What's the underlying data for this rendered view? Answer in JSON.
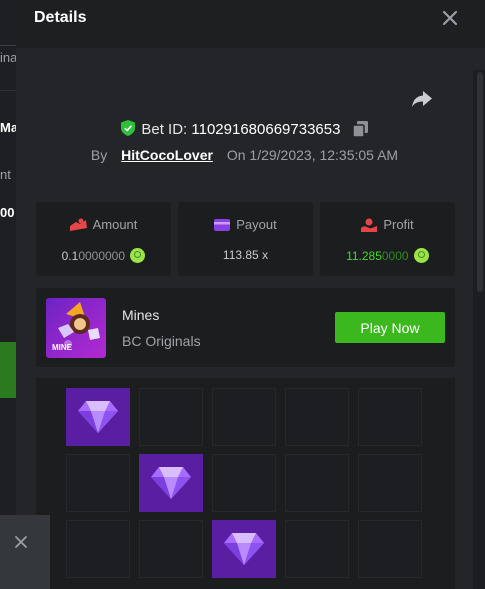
{
  "modal": {
    "title": "Details"
  },
  "bet": {
    "id_label": "Bet ID:",
    "id_value": "110291680669733653",
    "by_label": "By",
    "username": "HitCocoLover",
    "on_label": "On",
    "datetime": "1/29/2023, 12:35:05 AM"
  },
  "stats": {
    "amount_label": "Amount",
    "amount_bright": "0.1",
    "amount_dim": "0000000",
    "payout_label": "Payout",
    "payout_value": "113.85 x",
    "profit_label": "Profit",
    "profit_bright": "11.285",
    "profit_dim": "0000"
  },
  "game": {
    "name": "Mines",
    "provider": "BC Originals",
    "thumb_text": "MINE",
    "play_label": "Play Now"
  },
  "board": {
    "tiles": [
      [
        "gem",
        "empty",
        "empty",
        "empty",
        "empty"
      ],
      [
        "empty",
        "gem",
        "empty",
        "empty",
        "empty"
      ],
      [
        "empty",
        "empty",
        "gem",
        "empty",
        "empty"
      ]
    ]
  },
  "background": {
    "fragments": [
      "ina",
      "Ma",
      "nt",
      "00"
    ]
  },
  "colors": {
    "accent_green": "#3cb81f",
    "gem_tile": "#5a1ea3",
    "profit_green": "#45d62a",
    "shield_green": "#2fbf3a"
  },
  "icons": {
    "close": "close-icon",
    "share": "share-icon",
    "verified": "shield-check-icon",
    "copy": "copy-icon",
    "amount": "amount-icon",
    "payout": "wallet-icon",
    "profit": "profit-icon",
    "coin": "coin-icon",
    "gem": "gem-icon"
  }
}
